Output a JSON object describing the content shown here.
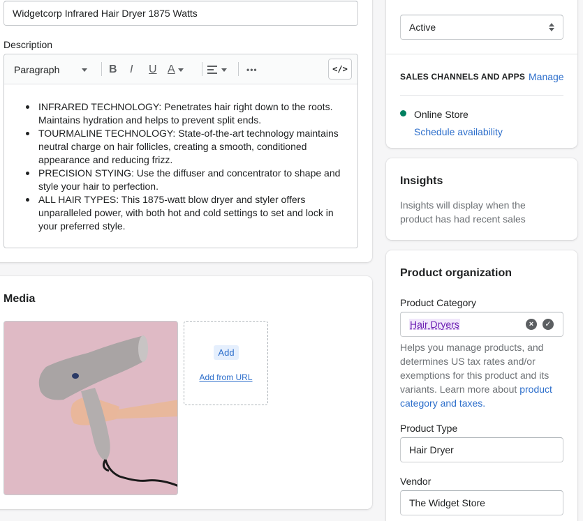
{
  "product": {
    "title_value": "Widgetcorp Infrared Hair Dryer 1875 Watts"
  },
  "description": {
    "label": "Description",
    "toolbar": {
      "paragraph": "Paragraph",
      "bold": "B",
      "italic": "I",
      "underline": "U",
      "text_color": "A",
      "more": "•••",
      "code": "</>"
    },
    "bullets": [
      "INFRARED TECHNOLOGY: Penetrates hair right down to the roots. Maintains hydration and helps to prevent split ends.",
      "TOURMALINE TECHNOLOGY: State-of-the-art technology maintains neutral charge on hair follicles, creating a smooth, conditioned appearance and reducing frizz.",
      "PRECISION STYING: Use the diffuser and concentrator to shape and style your hair to perfection.",
      "ALL HAIR TYPES: This 1875-watt blow dryer and styler offers unparalleled power, with both hot and cold settings to set and lock in your preferred style."
    ]
  },
  "media": {
    "heading": "Media",
    "add_label": "Add",
    "add_url_label": "Add from URL"
  },
  "status": {
    "value": "Active"
  },
  "sales_channels": {
    "heading": "SALES CHANNELS AND APPS",
    "manage_label": "Manage",
    "channel_name": "Online Store",
    "channel_status_color": "#008060",
    "schedule_label": "Schedule availability"
  },
  "insights": {
    "heading": "Insights",
    "text": "Insights will display when the product has had recent sales"
  },
  "organization": {
    "heading": "Product organization",
    "category_label": "Product Category",
    "category_value": "Hair Dryers",
    "category_help": "Helps you manage products, and determines US tax rates and/or exemptions for this product and its variants. Learn more about",
    "category_help_link": "product category and taxes.",
    "type_label": "Product Type",
    "type_value": "Hair Dryer",
    "vendor_label": "Vendor",
    "vendor_value": "The Widget Store"
  },
  "colors": {
    "accent": "#2c6ecb",
    "background": "#f6f6f7",
    "media_image_bg": "#dfbac5"
  },
  "icons": {
    "clear": "clear-icon",
    "confirm": "checkmark-icon"
  }
}
